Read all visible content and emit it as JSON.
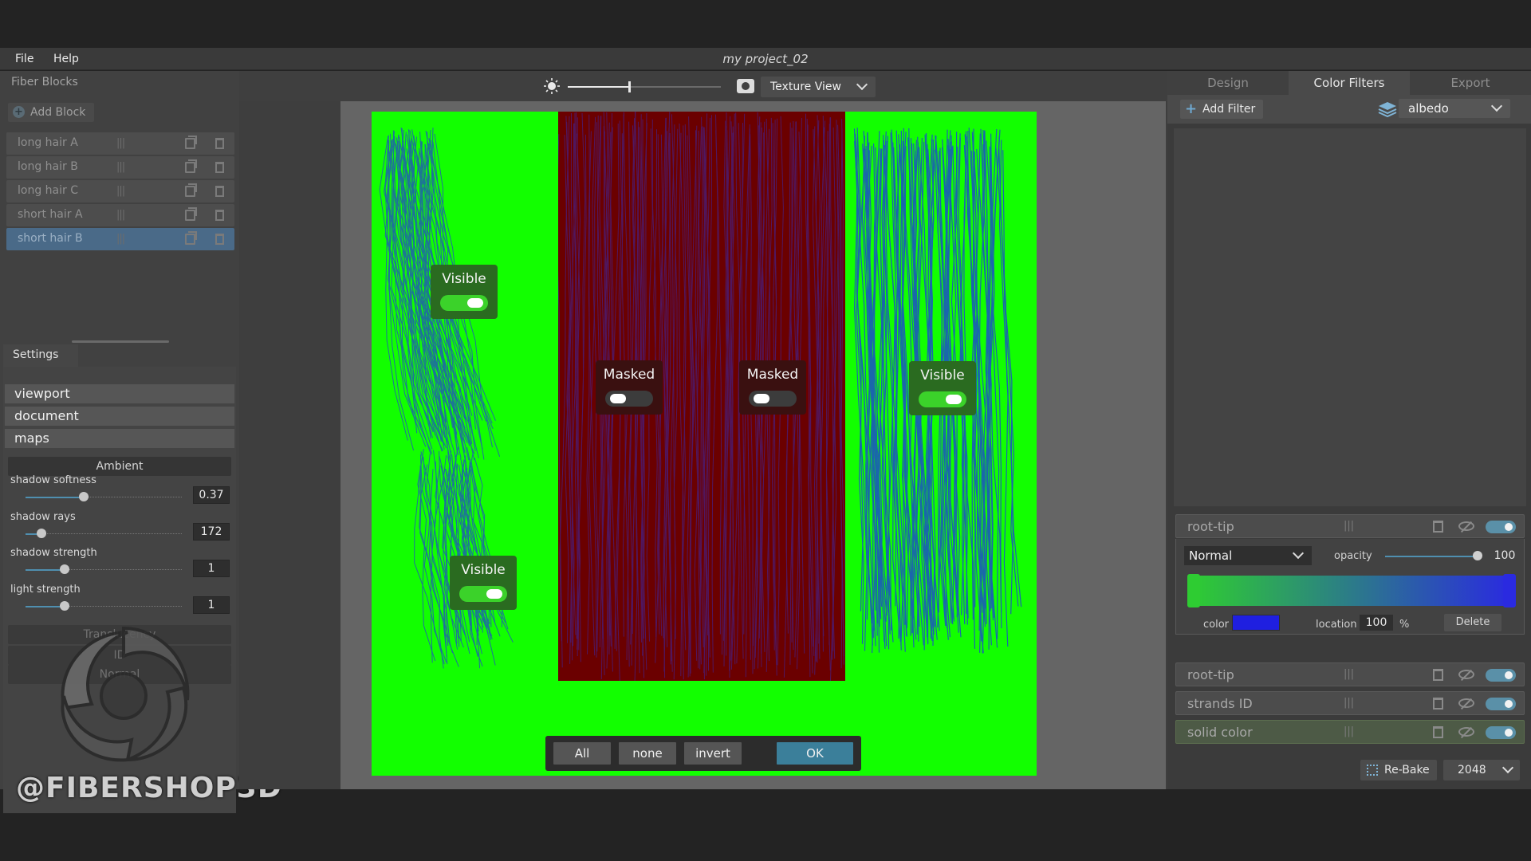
{
  "window": {
    "title": "my project_02"
  },
  "menu": {
    "items": [
      "File",
      "Help"
    ]
  },
  "left_panel": {
    "title": "Fiber Blocks",
    "add_block_label": "Add Block",
    "blocks": [
      {
        "name": "long hair A",
        "selected": false
      },
      {
        "name": "long hair B",
        "selected": false
      },
      {
        "name": "long hair C",
        "selected": false
      },
      {
        "name": "short hair A",
        "selected": false
      },
      {
        "name": "short hair B",
        "selected": true
      }
    ]
  },
  "settings": {
    "tab_label": "Settings",
    "categories": [
      "viewport",
      "document",
      "maps"
    ],
    "ambient_header": "Ambient",
    "properties": [
      {
        "label": "shadow softness",
        "value": "0.37",
        "fraction": 0.37
      },
      {
        "label": "shadow rays",
        "value": "172",
        "fraction": 0.1
      },
      {
        "label": "shadow strength",
        "value": "1",
        "fraction": 0.25
      },
      {
        "label": "light strength",
        "value": "1",
        "fraction": 0.25
      }
    ],
    "collapsed_sections": [
      "Translucency",
      "ID",
      "Normal"
    ]
  },
  "watermark": "@FIBERSHOP3D",
  "viewport": {
    "brightness_fraction": 0.4,
    "view_mode": "Texture View",
    "badges": {
      "left_top": {
        "label": "Visible",
        "on": true
      },
      "left_bottom": {
        "label": "Visible",
        "on": true
      },
      "mask_a": {
        "label": "Masked",
        "on": false
      },
      "mask_b": {
        "label": "Masked",
        "on": false
      },
      "right": {
        "label": "Visible",
        "on": true
      }
    },
    "mask_buttons": {
      "all": "All",
      "none": "none",
      "invert": "invert",
      "ok": "OK"
    },
    "colors": {
      "visible": "#12ff00",
      "masked": "#6b0000",
      "strands": "#2244cc"
    }
  },
  "right_panel": {
    "tabs": [
      {
        "label": "Design",
        "active": false
      },
      {
        "label": "Color Filters",
        "active": true
      },
      {
        "label": "Export",
        "active": false
      }
    ],
    "add_filter_label": "Add Filter",
    "channel": "albedo",
    "filters": [
      {
        "name": "root-tip",
        "expanded": true
      },
      {
        "name": "root-tip",
        "expanded": false
      },
      {
        "name": "strands ID",
        "expanded": false
      },
      {
        "name": "solid color",
        "expanded": false,
        "highlight": true
      }
    ],
    "expanded_filter": {
      "blend_mode": "Normal",
      "opacity_label": "opacity",
      "opacity_value": "100",
      "gradient_start": "#2ecc32",
      "gradient_end": "#2a2ae0",
      "color_label": "color",
      "color": "#1f1fe0",
      "location_label": "location",
      "location_value": "100",
      "location_unit": "%",
      "delete_label": "Delete"
    },
    "rebake_label": "Re-Bake",
    "resolution": "2048"
  }
}
